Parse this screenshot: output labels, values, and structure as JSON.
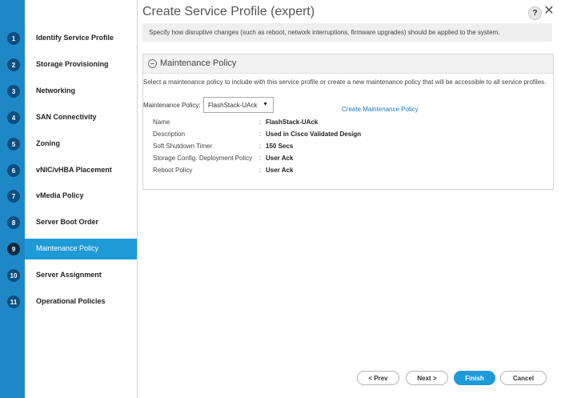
{
  "window": {
    "title": "Create Service Profile (expert)",
    "help_glyph": "?",
    "close_glyph": "✕"
  },
  "colors": {
    "accent": "#1e9bd7",
    "rail": "#1e88c7",
    "link": "#1f78c1"
  },
  "steps": [
    {
      "num": "1",
      "label": "Identify Service Profile"
    },
    {
      "num": "2",
      "label": "Storage Provisioning"
    },
    {
      "num": "3",
      "label": "Networking"
    },
    {
      "num": "4",
      "label": "SAN Connectivity"
    },
    {
      "num": "5",
      "label": "Zoning"
    },
    {
      "num": "6",
      "label": "vNIC/vHBA Placement"
    },
    {
      "num": "7",
      "label": "vMedia Policy"
    },
    {
      "num": "8",
      "label": "Server Boot Order"
    },
    {
      "num": "9",
      "label": "Maintenance Policy",
      "active": true
    },
    {
      "num": "10",
      "label": "Server Assignment"
    },
    {
      "num": "11",
      "label": "Operational Policies"
    }
  ],
  "banner": "Specify how disruptive changes (such as reboot, network interruptions, firmware upgrades) should be applied to the system.",
  "panel": {
    "title": "Maintenance Policy",
    "description": "Select a maintenance policy to include with this service profile or create a new maintenance policy that will be accessible to all service profiles.",
    "policy_label": "Maintenance Policy:",
    "selected_policy": "FlashStack-UAck",
    "create_link": "Create Maintenance Policy",
    "details": [
      {
        "key": "Name",
        "value": "FlashStack-UAck"
      },
      {
        "key": "Description",
        "value": "Used in Cisco Validated Design"
      },
      {
        "key": "Soft Shutdown Timer",
        "value": "150 Secs"
      },
      {
        "key": "Storage Config. Deployment Policy",
        "value": "User Ack"
      },
      {
        "key": "Reboot Policy",
        "value": "User Ack"
      }
    ]
  },
  "footer": {
    "prev": "< Prev",
    "next": "Next >",
    "finish": "Finish",
    "cancel": "Cancel"
  }
}
